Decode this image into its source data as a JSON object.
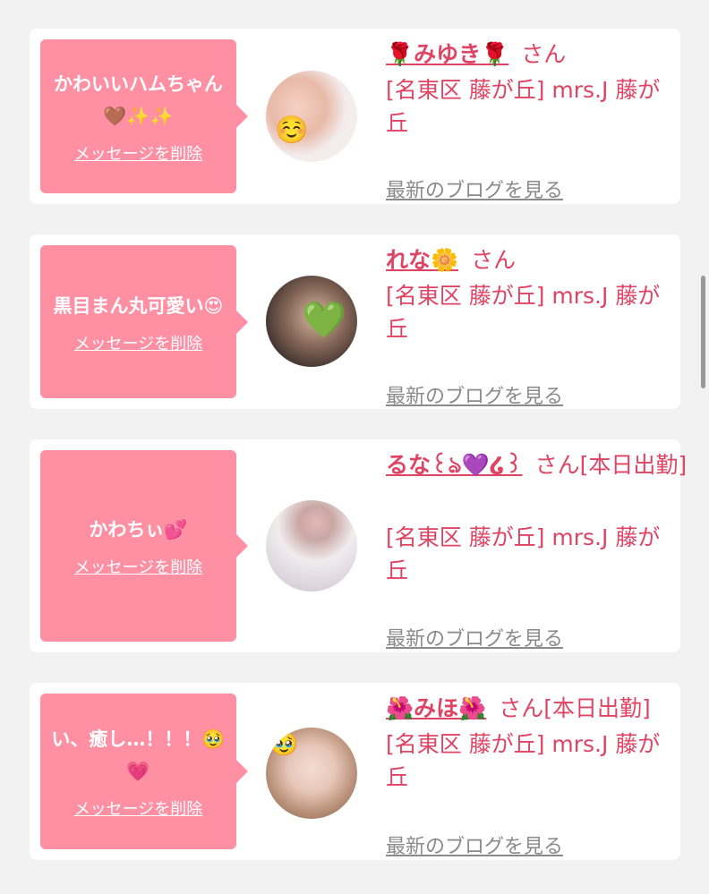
{
  "cards": [
    {
      "message": "かわいいハムちゃん🤎✨✨",
      "delete_label": "メッセージを削除",
      "name": "🌹みゆき🌹",
      "honorific": "さん",
      "shop": "[名東区 藤が丘] mrs.J 藤が丘",
      "blog_label": "最新のブログを見る",
      "avatar_overlay": "☺️"
    },
    {
      "message": "黒目まん丸可愛い😍",
      "delete_label": "メッセージを削除",
      "name": "れな🌼",
      "honorific": "さん",
      "shop": "[名東区 藤が丘] mrs.J 藤が丘",
      "blog_label": "最新のブログを見る",
      "avatar_overlay": "💚"
    },
    {
      "message": "かわちぃ💕",
      "delete_label": "メッセージを削除",
      "name": "るな꒰ঌ💜໒꒱",
      "honorific": "さん[本日出勤]",
      "shop": "[名東区 藤が丘] mrs.J 藤が丘",
      "blog_label": "最新のブログを見る",
      "avatar_overlay": ""
    },
    {
      "message": "い、癒し…！！！🥹💗",
      "delete_label": "メッセージを削除",
      "name": "🌺みほ🌺",
      "honorific": "さん[本日出勤]",
      "shop": "[名東区 藤が丘] mrs.J 藤が丘",
      "blog_label": "最新のブログを見る",
      "avatar_overlay": "🥹"
    }
  ]
}
